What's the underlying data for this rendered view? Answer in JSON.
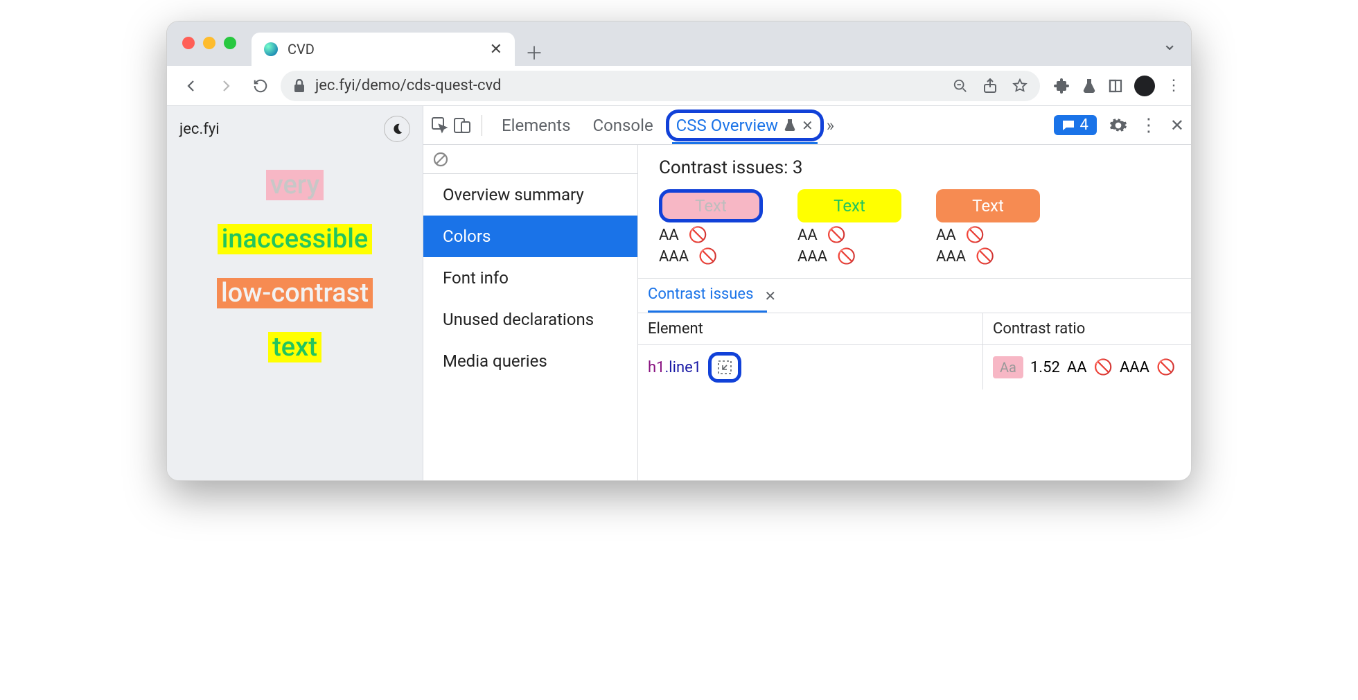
{
  "browser": {
    "tab_title": "CVD",
    "url_display": "jec.fyi/demo/cds-quest-cvd"
  },
  "page": {
    "site_label": "jec.fyi",
    "words": [
      "very",
      "inaccessible",
      "low-contrast",
      "text"
    ]
  },
  "devtools": {
    "tabs": [
      "Elements",
      "Console",
      "CSS Overview"
    ],
    "active_tab": "CSS Overview",
    "messages_count": "4",
    "nav": [
      "Overview summary",
      "Colors",
      "Font info",
      "Unused declarations",
      "Media queries"
    ],
    "nav_selected": "Colors",
    "contrast_heading": "Contrast issues: 3",
    "swatches": [
      {
        "label": "Text",
        "bg": "#f7b7c5",
        "fg": "#bdbdbd"
      },
      {
        "label": "Text",
        "bg": "#ffff00",
        "fg": "#22c55e"
      },
      {
        "label": "Text",
        "bg": "#f68b52",
        "fg": "#ffffff"
      }
    ],
    "aa_labels": {
      "aa": "AA",
      "aaa": "AAA"
    },
    "subtab": "Contrast issues",
    "table": {
      "cols": [
        "Element",
        "Contrast ratio"
      ],
      "row": {
        "element_tag": "h1",
        "element_class": ".line1",
        "sample": "Aa",
        "ratio": "1.52",
        "aa": "AA",
        "aaa": "AAA"
      }
    }
  }
}
